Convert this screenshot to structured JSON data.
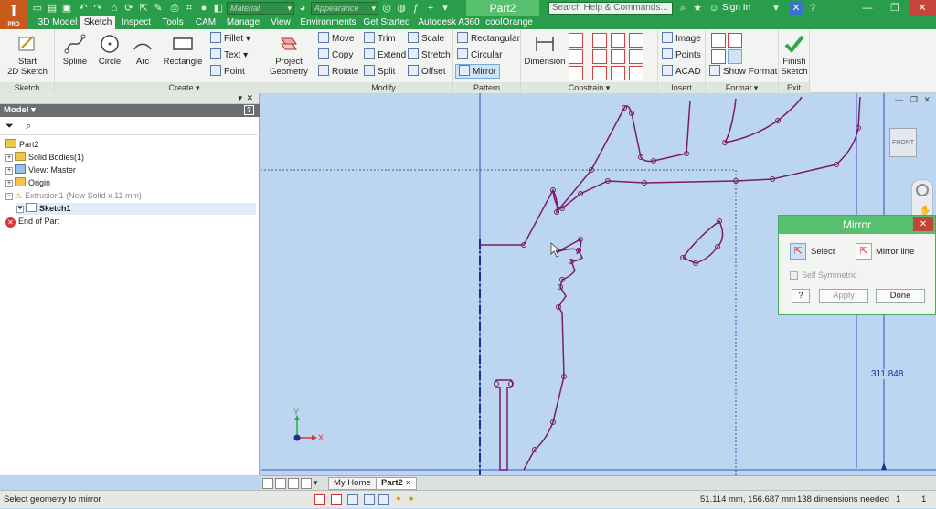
{
  "app": {
    "logo_text": "I",
    "logo_sub": "PRO",
    "document_title": "Part2"
  },
  "quick_access": {
    "material_combo": "Material",
    "appearance_combo": "Appearance"
  },
  "search": {
    "placeholder": "Search Help & Commands..."
  },
  "account": {
    "sign_in": "Sign In"
  },
  "menu_tabs": [
    "3D Model",
    "Sketch",
    "Inspect",
    "Tools",
    "CAM",
    "Manage",
    "View",
    "Environments",
    "Get Started",
    "Autodesk A360",
    "coolOrange"
  ],
  "active_tab": "Sketch",
  "ribbon": {
    "sketch": {
      "label": "Sketch",
      "start_line1": "Start",
      "start_line2": "2D Sketch"
    },
    "create": {
      "label": "Create",
      "spline": "Spline",
      "circle": "Circle",
      "arc": "Arc",
      "rectangle": "Rectangle",
      "fillet": "Fillet",
      "text": "Text",
      "point": "Point",
      "project_line1": "Project",
      "project_line2": "Geometry"
    },
    "modify": {
      "label": "Modify",
      "move": "Move",
      "copy": "Copy",
      "rotate": "Rotate",
      "trim": "Trim",
      "extend": "Extend",
      "split": "Split",
      "scale": "Scale",
      "stretch": "Stretch",
      "offset": "Offset"
    },
    "pattern": {
      "label": "Pattern",
      "rectangular": "Rectangular",
      "circular": "Circular",
      "mirror": "Mirror"
    },
    "constrain": {
      "label": "Constrain",
      "dimension": "Dimension"
    },
    "insert": {
      "label": "Insert",
      "image": "Image",
      "points": "Points",
      "acad": "ACAD"
    },
    "format": {
      "label": "Format",
      "show_format": "Show Format"
    },
    "exit": {
      "label": "Exit",
      "finish_line1": "Finish",
      "finish_line2": "Sketch"
    }
  },
  "browser": {
    "title": "Model",
    "nodes": [
      {
        "label": "Part2"
      },
      {
        "label": "Solid Bodies(1)"
      },
      {
        "label": "View: Master"
      },
      {
        "label": "Origin"
      },
      {
        "label": "Extrusion1 (New Solid x 11 mm)"
      },
      {
        "label": "Sketch1"
      },
      {
        "label": "End of Part"
      }
    ]
  },
  "canvas": {
    "viewcube_label": "FRONT",
    "dimension_value": "311.848",
    "triad_x": "X",
    "triad_y": "Y"
  },
  "mirror_dialog": {
    "title": "Mirror",
    "select": "Select",
    "mirror_line": "Mirror line",
    "self_symmetric": "Self Symmetric",
    "help": "?",
    "apply": "Apply",
    "done": "Done"
  },
  "doc_tabs": [
    {
      "label": "My Home"
    },
    {
      "label": "Part2"
    }
  ],
  "status": {
    "prompt": "Select geometry to mirror",
    "coordinates": "51.114 mm, 156.687 mm",
    "dimensions_needed": "138 dimensions needed",
    "count_a": "1",
    "count_b": "1"
  },
  "colors": {
    "title_green": "#2a9d4a",
    "canvas_bg": "#bcd6f2",
    "sketch_line": "#7a1a6e",
    "axis_blue": "#1a2e8e"
  }
}
